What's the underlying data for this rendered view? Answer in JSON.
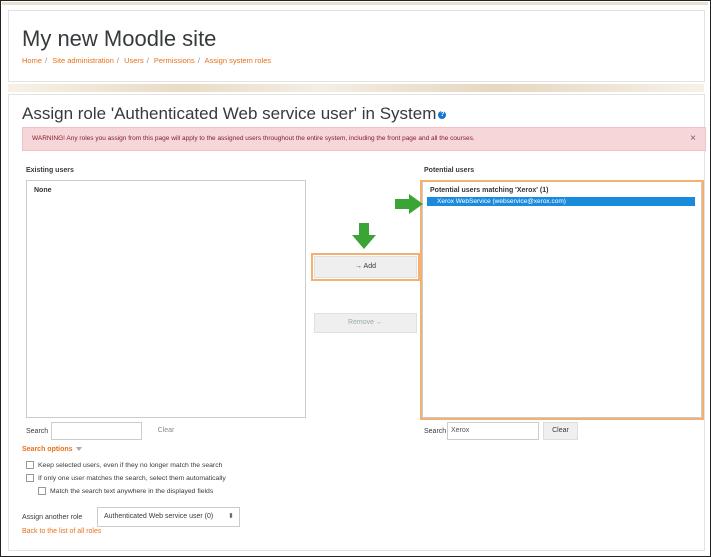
{
  "site": {
    "title": "My new Moodle site"
  },
  "breadcrumb": [
    "Home",
    "Site administration",
    "Users",
    "Permissions",
    "Assign system roles"
  ],
  "page": {
    "heading": "Assign role 'Authenticated Web service user' in System",
    "help_icon": "?"
  },
  "alert": {
    "text": "WARNING! Any roles you assign from this page will apply to the assigned users throughout the entire system, including the front page and all the courses.",
    "close": "×"
  },
  "existing": {
    "label": "Existing users",
    "group": "None",
    "search_label": "Search",
    "search_value": "",
    "clear_label": "Clear"
  },
  "potential": {
    "label": "Potential users",
    "group": "Potential users matching 'Xerox' (1)",
    "option": "Xerox WebService (webservice@xerox.com)",
    "search_label": "Search",
    "search_value": "Xerox",
    "clear_label": "Clear"
  },
  "buttons": {
    "add": "→ Add",
    "remove": "Remove ←"
  },
  "search_options": {
    "label": "Search options",
    "options": [
      "Keep selected users, even if they no longer match the search",
      "If only one user matches the search, select them automatically",
      "Match the search text anywhere in the displayed fields"
    ]
  },
  "assign_another": {
    "label": "Assign another role",
    "selected": "Authenticated Web service user (0)",
    "updown": "⬍"
  },
  "back_link": "Back to the list of all roles",
  "colors": {
    "link": "#e8711a",
    "highlight": "#f3b071",
    "arrow": "#3aa536",
    "selected_option": "#1a8bdc"
  }
}
